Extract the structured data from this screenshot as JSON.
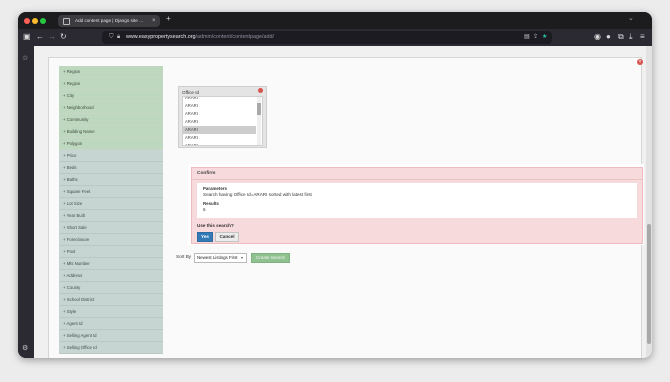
{
  "browser": {
    "tab_title": "Add content page | Django site adm",
    "tab_close": "×",
    "new_tab": "+",
    "tabs_menu": "⌄",
    "url_host": "www.easypropertysearch.org",
    "url_path": "/admin/content/contentpage/add/"
  },
  "left_filters": {
    "items": [
      {
        "label": "+ Region",
        "style": "green"
      },
      {
        "label": "+ Region",
        "style": "green"
      },
      {
        "label": "+ City",
        "style": "green"
      },
      {
        "label": "+ Neighborhood",
        "style": "green"
      },
      {
        "label": "+ Community",
        "style": "green"
      },
      {
        "label": "+ Building Name",
        "style": "green"
      },
      {
        "label": "+ Polygon",
        "style": "green"
      },
      {
        "label": "+ Price",
        "style": "gray"
      },
      {
        "label": "+ Beds",
        "style": "gray"
      },
      {
        "label": "+ Baths",
        "style": "gray"
      },
      {
        "label": "+ Square Feet",
        "style": "gray"
      },
      {
        "label": "+ Lot Size",
        "style": "gray"
      },
      {
        "label": "+ Year Built",
        "style": "gray"
      },
      {
        "label": "+ Short Sale",
        "style": "gray"
      },
      {
        "label": "+ Foreclosure",
        "style": "gray"
      },
      {
        "label": "+ Pool",
        "style": "gray"
      },
      {
        "label": "+ Mls Number",
        "style": "gray"
      },
      {
        "label": "+ Address",
        "style": "gray"
      },
      {
        "label": "+ County",
        "style": "gray"
      },
      {
        "label": "+ School District",
        "style": "gray"
      },
      {
        "label": "+ Style",
        "style": "gray"
      },
      {
        "label": "+ Agent Id",
        "style": "gray"
      },
      {
        "label": "+ Selling Agent Id",
        "style": "gray"
      },
      {
        "label": "+ Selling Office Id",
        "style": "gray"
      }
    ]
  },
  "office_box": {
    "title": "Office Id",
    "rows": [
      {
        "label": "ARARI",
        "selected": false
      },
      {
        "label": "ARARI",
        "selected": false
      },
      {
        "label": "ARARI",
        "selected": false
      },
      {
        "label": "ARARI",
        "selected": false
      },
      {
        "label": "ARARI",
        "selected": true
      },
      {
        "label": "ARARI",
        "selected": false
      },
      {
        "label": "ARARI",
        "selected": false
      }
    ]
  },
  "sort": {
    "label": "Sort By",
    "value": "Newest Listings First",
    "create_button": "Create Search"
  },
  "confirm": {
    "title": "Confirm",
    "parameters_heading": "Parameters",
    "parameters_text": "Search having Office Id=ARARI sorted with latest first",
    "results_heading": "Results",
    "results_value": "6",
    "question": "Use this search?",
    "yes_label": "Yes",
    "cancel_label": "Cancel"
  }
}
